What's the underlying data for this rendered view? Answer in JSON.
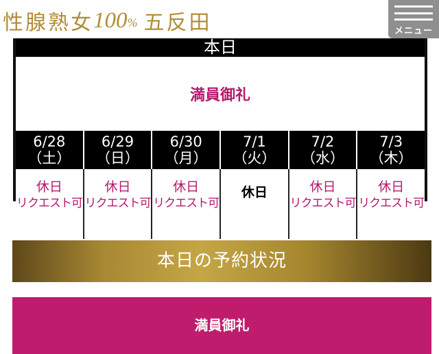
{
  "header": {
    "logo_text": "性腺熟女",
    "logo_number": "100",
    "logo_percent": "%",
    "logo_area": "五反田",
    "menu_label": "メニュー"
  },
  "schedule": {
    "today_label": "本日",
    "today_status": "満員御礼",
    "days": [
      {
        "date": "6/28",
        "weekday": "（土）",
        "status_line1": "休日",
        "status_line2": "リクエスト可"
      },
      {
        "date": "6/29",
        "weekday": "（日）",
        "status_line1": "休日",
        "status_line2": "リクエスト可"
      },
      {
        "date": "6/30",
        "weekday": "（月）",
        "status_line1": "休日",
        "status_line2": "リクエスト可"
      },
      {
        "date": "7/1",
        "weekday": "（火）",
        "status_line1": "休日",
        "status_line2": ""
      },
      {
        "date": "7/2",
        "weekday": "（水）",
        "status_line1": "休日",
        "status_line2": "リクエスト可"
      },
      {
        "date": "7/3",
        "weekday": "（木）",
        "status_line1": "休日",
        "status_line2": "リクエスト可"
      }
    ]
  },
  "reservation": {
    "title": "本日の予約状況",
    "status": "満員御礼"
  },
  "colors": {
    "accent_magenta": "#c01c6e",
    "gold": "#b08d3a",
    "menu_gray": "#8f8f8f"
  }
}
